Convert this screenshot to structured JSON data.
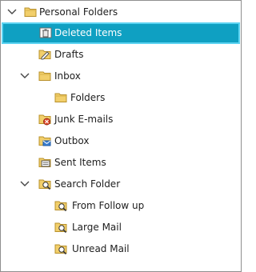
{
  "folder_tree": {
    "items": [
      {
        "label": "Personal Folders",
        "icon": "folder-icon",
        "expanded": true,
        "selected": false
      },
      {
        "label": "Deleted Items",
        "icon": "trash-icon",
        "selected": true
      },
      {
        "label": "Drafts",
        "icon": "drafts-icon",
        "selected": false
      },
      {
        "label": "Inbox",
        "icon": "inbox-icon",
        "expanded": true,
        "selected": false
      },
      {
        "label": "Folders",
        "icon": "folder-icon",
        "selected": false
      },
      {
        "label": "Junk E-mails",
        "icon": "junk-icon",
        "selected": false
      },
      {
        "label": "Outbox",
        "icon": "outbox-icon",
        "selected": false
      },
      {
        "label": "Sent Items",
        "icon": "sent-items-icon",
        "selected": false
      },
      {
        "label": "Search Folder",
        "icon": "search-folder-icon",
        "expanded": true,
        "selected": false
      },
      {
        "label": "From Follow up",
        "icon": "search-folder-icon",
        "selected": false
      },
      {
        "label": "Large Mail",
        "icon": "search-folder-icon",
        "selected": false
      },
      {
        "label": "Unread Mail",
        "icon": "search-folder-icon",
        "selected": false
      }
    ]
  },
  "colors": {
    "selection_fill": "#0fa0c2",
    "selection_border": "#5cd3f1",
    "folder_yellow": "#f2cf6b",
    "text": "#1e1e1e"
  }
}
